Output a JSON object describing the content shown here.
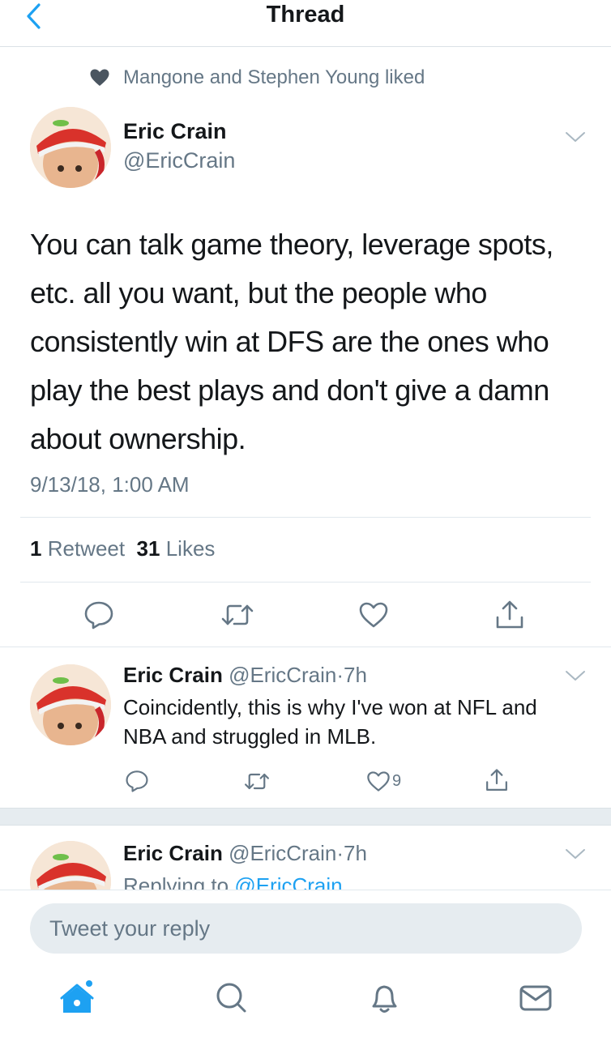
{
  "header": {
    "title": "Thread"
  },
  "social_context": {
    "text": "Mangone and Stephen Young liked"
  },
  "main_tweet": {
    "name": "Eric Crain",
    "handle": "@EricCrain",
    "text": "You can talk game theory, leverage spots, etc. all you want, but the people who consistently win at DFS are the ones who play the best plays and don't give a damn about ownership.",
    "timestamp": "9/13/18, 1:00 AM",
    "retweet_count": "1",
    "retweet_label": "Retweet",
    "like_count": "31",
    "like_label": "Likes"
  },
  "reply_1": {
    "name": "Eric Crain",
    "handle": "@EricCrain",
    "separator": "·",
    "time": "7h",
    "text": "Coincidently, this is why I've won at NFL and NBA and struggled in MLB.",
    "like_count": "9"
  },
  "reply_2": {
    "name": "Eric Crain",
    "handle": "@EricCrain",
    "separator": "·",
    "time": "7h",
    "replying_prefix": "Replying to",
    "replying_handle": "@EricCrain"
  },
  "compose": {
    "placeholder": "Tweet your reply"
  },
  "colors": {
    "accent": "#1da1f2",
    "secondary_text": "#657786",
    "icon": "#657786"
  },
  "icons": [
    "back-icon",
    "heart-icon",
    "chevron-down-icon",
    "reply-icon",
    "retweet-icon",
    "like-icon",
    "share-icon",
    "home-icon",
    "search-icon",
    "notifications-icon",
    "messages-icon"
  ]
}
